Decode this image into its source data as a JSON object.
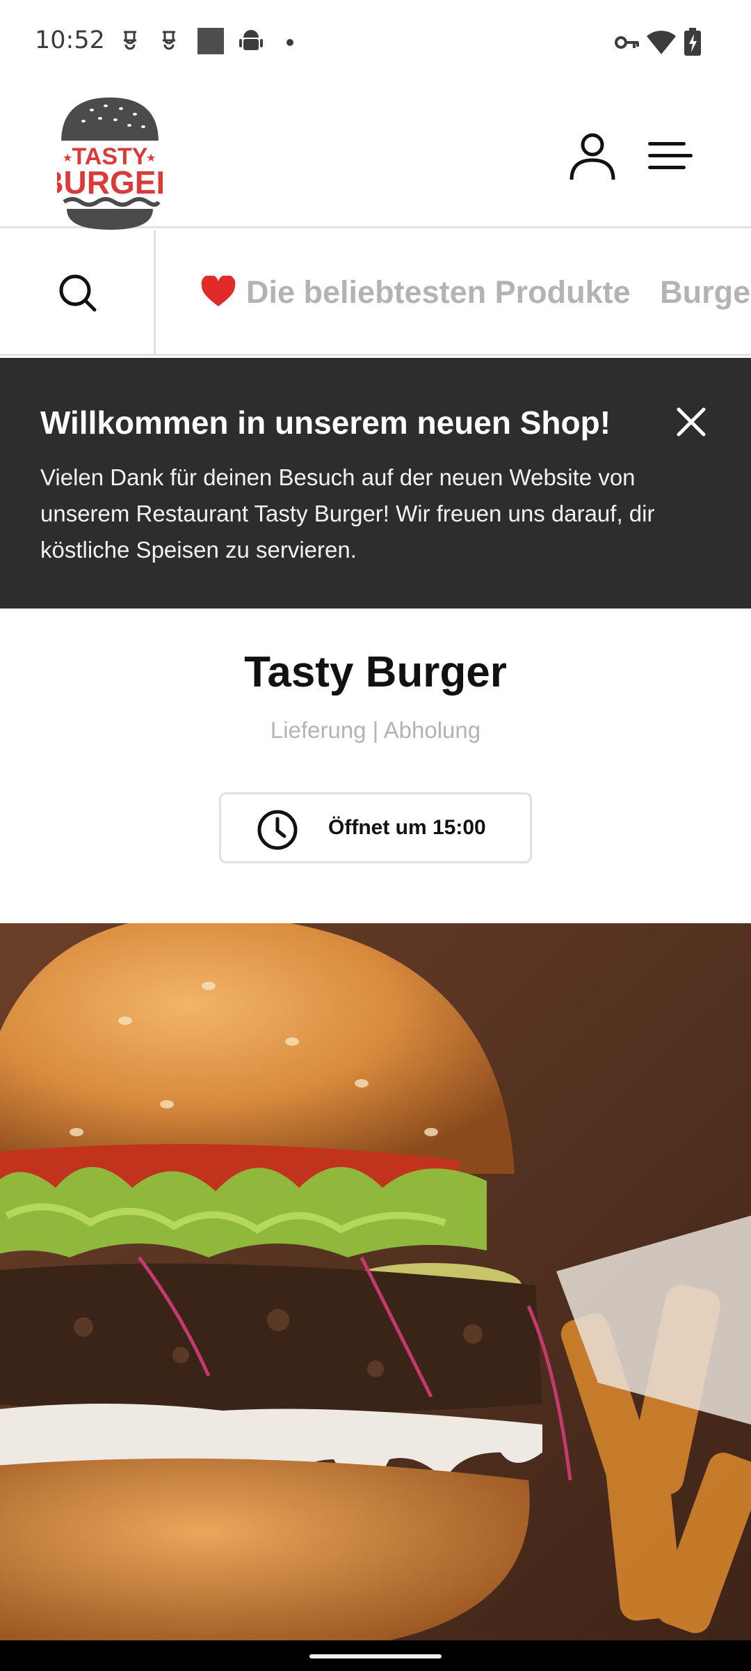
{
  "status_bar": {
    "time": "10:52",
    "left_icons": [
      "notification-icon",
      "notification-icon",
      "image-icon",
      "android-icon",
      "dot-icon"
    ],
    "right_icons": [
      "vpn-key-icon",
      "wifi-icon",
      "battery-charging-icon"
    ]
  },
  "header": {
    "logo": {
      "line1": "TASTY",
      "line2": "BURGER"
    },
    "account_icon": "user-icon",
    "menu_icon": "hamburger-menu-icon"
  },
  "category_bar": {
    "search_icon": "search-icon",
    "items": [
      {
        "label": "Die beliebtesten Produkte",
        "icon": "heart-icon"
      },
      {
        "label": "Burger"
      }
    ]
  },
  "welcome_banner": {
    "title": "Willkommen in unserem neuen Shop!",
    "text": "Vielen Dank für deinen Besuch auf der neuen Website von unserem Restaurant Tasty Burger! Wir freuen uns darauf, dir köstliche Speisen zu servieren."
  },
  "store": {
    "name": "Tasty Burger",
    "modes": "Lieferung | Abholung",
    "hours_label": "Öffnet um 15:00"
  },
  "colors": {
    "logo_red": "#d93a3a",
    "logo_dark": "#4b4b4b",
    "banner_bg": "#2d2d2d",
    "muted_text": "#b3b3b3",
    "divider": "#e2e2e2"
  }
}
